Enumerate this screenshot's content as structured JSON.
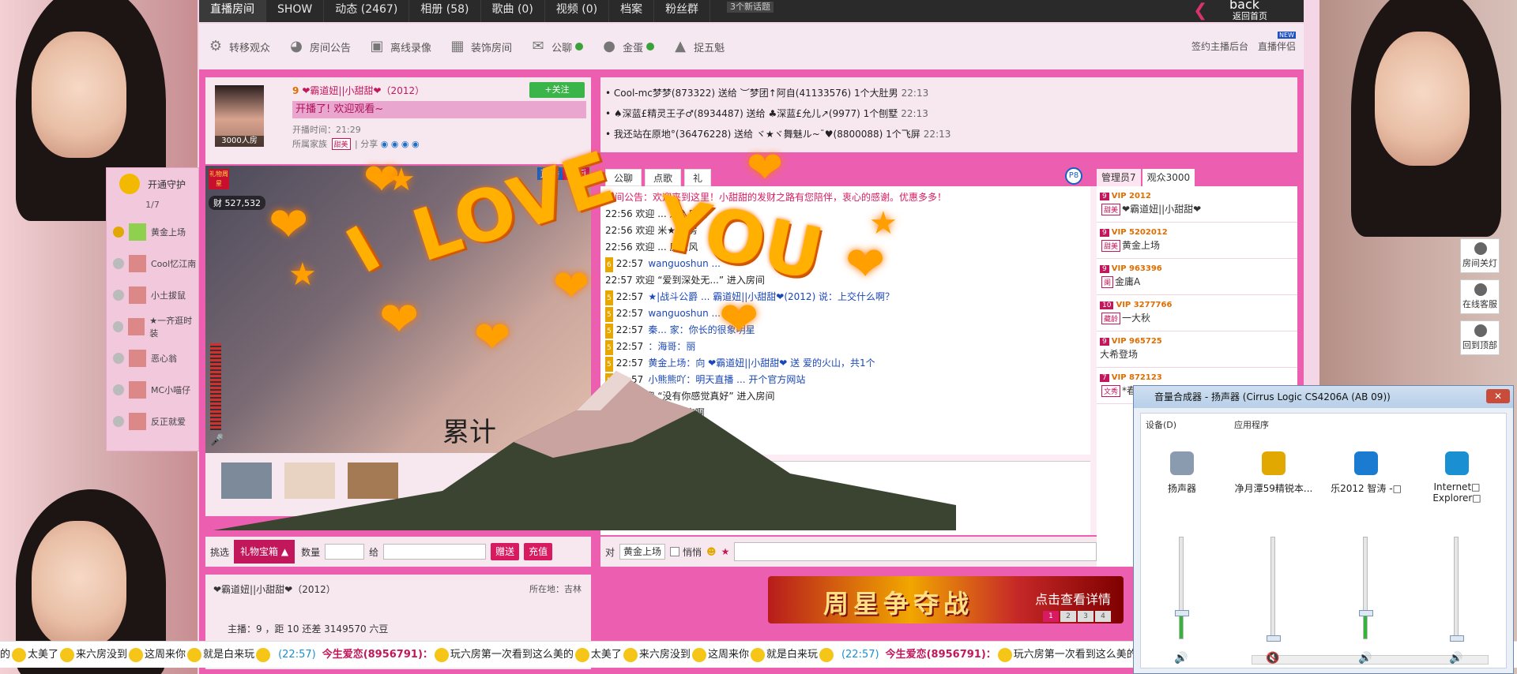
{
  "topnav": {
    "tabs": [
      "直播房间",
      "SHOW",
      "动态 (2467)",
      "相册 (58)",
      "歌曲 (0)",
      "视频 (0)",
      "档案",
      "粉丝群"
    ],
    "new_topics": "3个新话题",
    "back_label": "back",
    "back_sub": "返回首页"
  },
  "toolbar": {
    "items": [
      {
        "label": "转移观众",
        "icon": "transfer-icon"
      },
      {
        "label": "房间公告",
        "icon": "antenna-icon"
      },
      {
        "label": "离线录像",
        "icon": "video-icon"
      },
      {
        "label": "装饰房间",
        "icon": "decorate-icon"
      },
      {
        "label": "公聊",
        "icon": "chat-bubble-icon"
      },
      {
        "label": "金蛋",
        "icon": "location-pin-icon"
      },
      {
        "label": "捉五魁",
        "icon": "hat-icon"
      }
    ],
    "sign_anchor": "签约主播后台",
    "live_companion": "直播伴侣",
    "new_badge": "NEW"
  },
  "anchor": {
    "level": "9",
    "name": "❤霸道妞||小甜甜❤（2012）",
    "follow": "+关注",
    "welcome": "开播了! 欢迎观看~",
    "start_time": "开播时间：21:29",
    "family_label": "所属家族",
    "family_badge": "甜美",
    "share_label": "| 分享",
    "room_count": "3000人房"
  },
  "video": {
    "live": "直播",
    "hifi": "Hi-Fi",
    "wealth": "527,532",
    "gift_flag": "礼物周星",
    "caption": "累计"
  },
  "guard": {
    "title": "开通守护",
    "count": "1/7",
    "members": [
      "黄金上场",
      "Cool忆江南",
      "小土拔鼠",
      "★一齐逛时装",
      "恶心翁",
      "MC小喵仔",
      "反正就爱"
    ]
  },
  "giftbar": {
    "pick": "挑选",
    "box": "礼物宝箱",
    "qty": "数量",
    "to": "给",
    "send": "赠送",
    "recharge": "充值"
  },
  "anchorinfo": {
    "name": "❤霸道妞||小甜甜❤（2012）",
    "location": "所在地：吉林",
    "host_line": "主播：9 ，距 10 还差 3149570 六豆"
  },
  "feed": [
    {
      "text": "• Cool-mc梦梦(873322) 送给 ︶梦团↑阿自(41133576) 1个大肚男",
      "time": "22:13"
    },
    {
      "text": "• ♠深蓝£精灵王子♂(8934487) 送给 ♣深蓝£允儿↗(9977) 1个刨墅",
      "time": "22:13"
    },
    {
      "text": "• 我还站在原地°(36476228) 送给 ヾ★ヾ舞魅ル~ˉ♥(8800088) 1个飞屏",
      "time": "22:13"
    }
  ],
  "chat": {
    "tabs": [
      "公聊",
      "点歌",
      "礼"
    ],
    "p_badge": "P8",
    "messages": [
      {
        "kind": "ann",
        "text": "房间公告：欢迎来到这里！小甜甜的发财之路有您陪伴，衷心的感谢。优惠多多！"
      },
      {
        "kind": "plain",
        "text": "22:56 欢迎 ... 进入房间"
      },
      {
        "kind": "plain",
        "text": "22:56 欢迎 米★ 入房"
      },
      {
        "kind": "plain",
        "text": "22:56 欢迎 ... 房清风"
      },
      {
        "kind": "user",
        "rich": "6",
        "time": "22:57",
        "text": "wanguoshun ..."
      },
      {
        "kind": "plain",
        "text": "22:57 欢迎 “爱到深处无...” 进入房间"
      },
      {
        "kind": "user",
        "rich": "5",
        "time": "22:57",
        "text": "★|战斗公爵 ... 霸道妞||小甜甜❤(2012) 说：上交什么啊？"
      },
      {
        "kind": "user",
        "rich": "5",
        "time": "22:57",
        "text": "wanguoshun ..."
      },
      {
        "kind": "user",
        "rich": "5",
        "time": "22:57",
        "text": "秦... 家：你长的很象明星"
      },
      {
        "kind": "user",
        "rich": "5",
        "time": "22:57",
        "text": "：海哥：丽"
      },
      {
        "kind": "user",
        "rich": "5",
        "time": "22:57",
        "text": "黄金上场：向 ❤霸道妞||小甜甜❤ 送 爱的火山，共1个"
      },
      {
        "kind": "user",
        "rich": "5",
        "time": "22:57",
        "text": "小熊熊吖：明天直播 ... 开个官方网站"
      },
      {
        "kind": "plain",
        "text": "22:57 欢迎 “没有你感觉真好” 进入房间"
      },
      {
        "kind": "plain",
        "text": "22:57 ... 火山没反应啊"
      }
    ]
  },
  "talkbar": {
    "to": "对",
    "target": "黄金上场",
    "whisper": "悄悄"
  },
  "audience": {
    "tabs": [
      "管理员7",
      "观众3000"
    ],
    "users": [
      {
        "lvl": "9",
        "badge": "甜美",
        "line1": "VIP 2012",
        "line2": "❤霸道妞||小甜甜❤"
      },
      {
        "lvl": "9",
        "badge": "甜美",
        "line1": "VIP 5202012",
        "line2": "黄金上场"
      },
      {
        "lvl": "9",
        "badge": "阑",
        "line1": "VIP 963396",
        "line2": "金庸A"
      },
      {
        "lvl": "10",
        "badge": "藏龄",
        "line1": "VIP 3277766",
        "line2": "一大秋"
      },
      {
        "lvl": "9",
        "badge": "",
        "line1": "VIP 965725",
        "line2": "大希登场"
      },
      {
        "lvl": "7",
        "badge": "文秀",
        "line1": "VIP 872123",
        "line2": "*春哥*"
      }
    ]
  },
  "banner": {
    "title": "周星争夺战",
    "detail": "点击查看详情",
    "pages": [
      "1",
      "2",
      "3",
      "4"
    ]
  },
  "sidebtns": [
    "房间关灯",
    "在线客服",
    "回到顶部"
  ],
  "ticker": {
    "items": [
      {
        "type": "text",
        "v": "的"
      },
      {
        "type": "smile"
      },
      {
        "type": "text",
        "v": "太美了"
      },
      {
        "type": "smile"
      },
      {
        "type": "text",
        "v": "来六房没到"
      },
      {
        "type": "smile"
      },
      {
        "type": "text",
        "v": "这周来你"
      },
      {
        "type": "smile"
      },
      {
        "type": "text",
        "v": "就是白来玩"
      },
      {
        "type": "smile"
      },
      {
        "type": "time",
        "v": "(22:57)"
      },
      {
        "type": "who",
        "v": "今生爱恋(8956791)："
      },
      {
        "type": "smile"
      },
      {
        "type": "text",
        "v": "玩六房第一次看到这么美的"
      },
      {
        "type": "smile"
      },
      {
        "type": "text",
        "v": "太美了"
      },
      {
        "type": "smile"
      },
      {
        "type": "text",
        "v": "来六房没到"
      },
      {
        "type": "smile"
      },
      {
        "type": "text",
        "v": "这周来你"
      },
      {
        "type": "smile"
      },
      {
        "type": "text",
        "v": "就是白来玩"
      },
      {
        "type": "smile"
      },
      {
        "type": "time",
        "v": "(22:57)"
      },
      {
        "type": "who",
        "v": "今生爱恋(8956791)："
      },
      {
        "type": "smile"
      },
      {
        "type": "text",
        "v": "玩六房第一次看到这么美的"
      }
    ]
  },
  "mixer": {
    "title": "音量合成器 - 扬声器 (Cirrus Logic CS4206A (AB 09))",
    "device_label": "设备(D)",
    "apps_label": "应用程序",
    "columns": [
      {
        "name": "扬声器",
        "level": 0.25,
        "muted": false
      },
      {
        "name": "净月潭59精锐本...",
        "level": 0.0,
        "muted": true
      },
      {
        "name": "乐2012 智涛 -□",
        "level": 0.25,
        "muted": false
      },
      {
        "name": "Internet□ Explorer□",
        "level": 0.0,
        "muted": false
      }
    ]
  },
  "overlay": {
    "text": "I LOVE YOU"
  }
}
